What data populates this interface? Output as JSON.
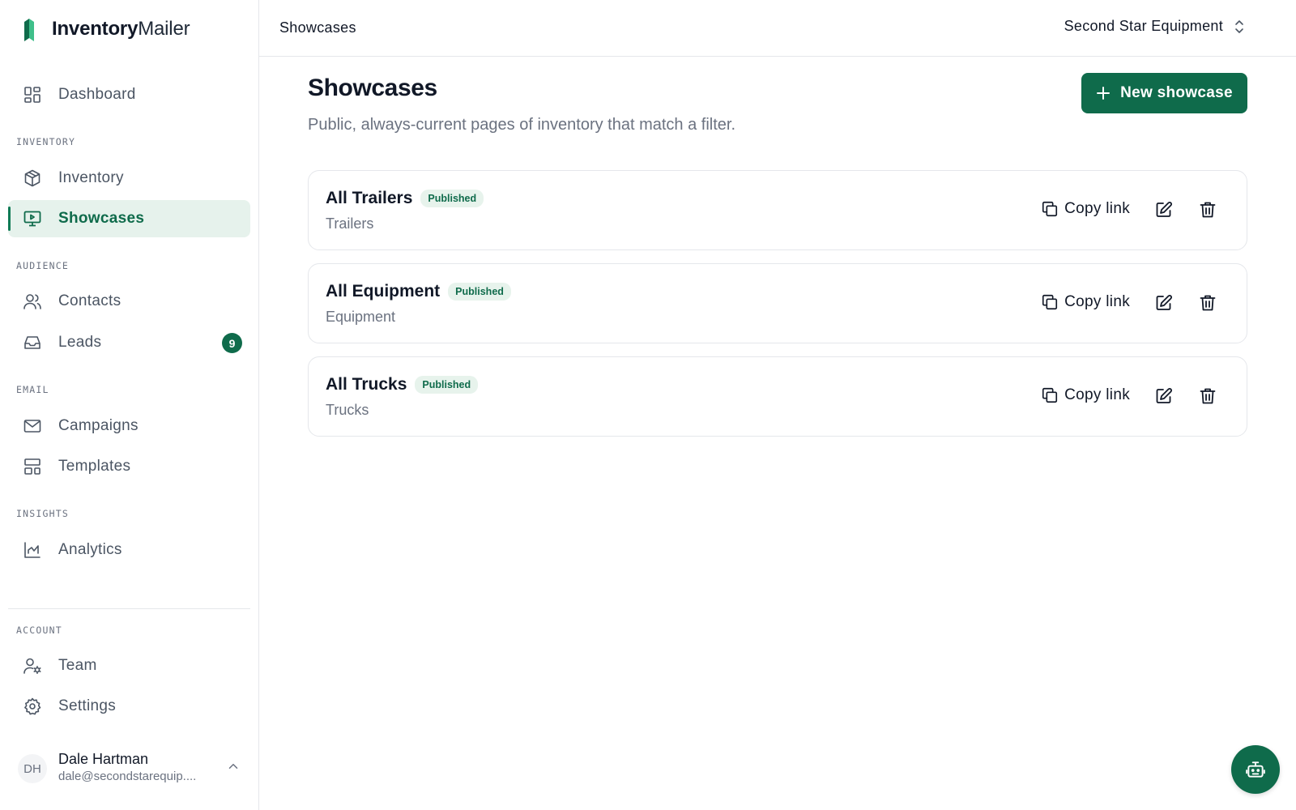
{
  "brand": {
    "bold": "Inventory",
    "light": "Mailer"
  },
  "colors": {
    "accent": "#0f6b4b",
    "accent_light": "#e6f2ec"
  },
  "sidebar": {
    "dashboard": {
      "label": "Dashboard",
      "icon": "dashboard-icon"
    },
    "sections": {
      "inventory": "INVENTORY",
      "audience": "AUDIENCE",
      "email": "EMAIL",
      "insights": "INSIGHTS",
      "account": "ACCOUNT"
    },
    "items": {
      "inventory": {
        "label": "Inventory",
        "icon": "cube-icon"
      },
      "showcases": {
        "label": "Showcases",
        "icon": "presentation-icon",
        "active": true
      },
      "contacts": {
        "label": "Contacts",
        "icon": "users-icon"
      },
      "leads": {
        "label": "Leads",
        "icon": "inbox-icon",
        "badge": "9"
      },
      "campaigns": {
        "label": "Campaigns",
        "icon": "mail-icon"
      },
      "templates": {
        "label": "Templates",
        "icon": "layout-icon"
      },
      "analytics": {
        "label": "Analytics",
        "icon": "chart-icon"
      },
      "team": {
        "label": "Team",
        "icon": "user-cog-icon"
      },
      "settings": {
        "label": "Settings",
        "icon": "gear-icon"
      }
    },
    "user": {
      "initials": "DH",
      "name": "Dale Hartman",
      "email": "dale@secondstarequip...."
    }
  },
  "topbar": {
    "title": "Showcases",
    "org": "Second Star Equipment"
  },
  "main": {
    "title": "Showcases",
    "subtitle": "Public, always-current pages of inventory that match a filter.",
    "new_button": "New showcase",
    "showcases": [
      {
        "title": "All Trailers",
        "status": "Published",
        "category": "Trailers",
        "copy_label": "Copy link"
      },
      {
        "title": "All Equipment",
        "status": "Published",
        "category": "Equipment",
        "copy_label": "Copy link"
      },
      {
        "title": "All Trucks",
        "status": "Published",
        "category": "Trucks",
        "copy_label": "Copy link"
      }
    ]
  },
  "fab": {
    "icon": "bot-icon"
  }
}
